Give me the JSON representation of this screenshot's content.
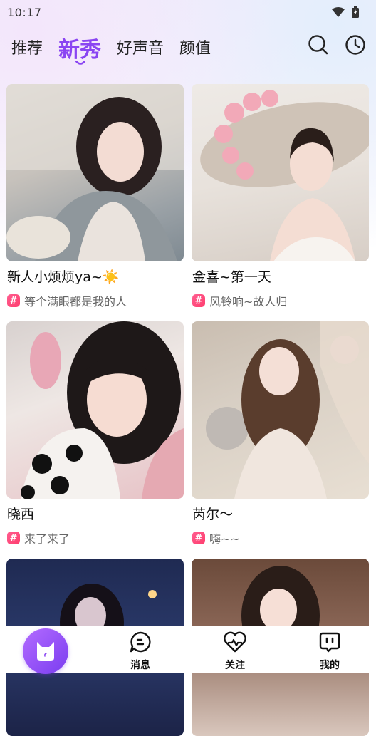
{
  "status_bar": {
    "time": "10:17"
  },
  "nav": {
    "tabs": [
      {
        "label": "推荐",
        "active": false
      },
      {
        "label": "新秀",
        "active": true
      },
      {
        "label": "好声音",
        "active": false
      },
      {
        "label": "颜值",
        "active": false
      }
    ],
    "icons": [
      "search-icon",
      "history-clock-icon"
    ],
    "accent_color": "#8a45f2"
  },
  "cards": [
    {
      "name": "新人小烦烦ya~☀️",
      "tag": "等个满眼都是我的人"
    },
    {
      "name": "金喜~第一天",
      "tag": "风铃响~故人归"
    },
    {
      "name": "晓西",
      "tag": "来了来了"
    },
    {
      "name": "芮尔～",
      "tag": "嗨~~"
    },
    {
      "name": "",
      "tag": ""
    },
    {
      "name": "",
      "tag": ""
    }
  ],
  "bottom_nav": {
    "items": [
      {
        "label": "",
        "icon": "home-cat-icon"
      },
      {
        "label": "消息",
        "icon": "message-icon"
      },
      {
        "label": "关注",
        "icon": "heart-pulse-icon"
      },
      {
        "label": "我的",
        "icon": "profile-face-icon"
      }
    ]
  }
}
